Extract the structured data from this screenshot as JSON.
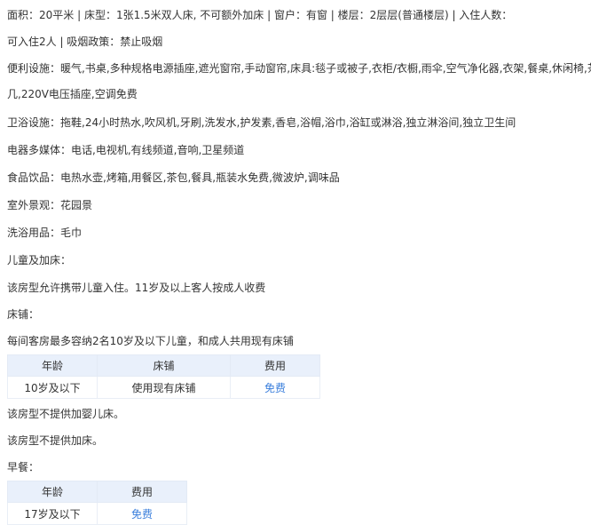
{
  "lines": {
    "area_line": "面积：20平米 | 床型：1张1.5米双人床, 不可额外加床 | 窗户：有窗 | 楼层：2层层(普通楼层) | 入住人数：",
    "occupancy_line": "可入住2人 | 吸烟政策：禁止吸烟",
    "facilities_line1": "便利设施：暖气,书桌,多种规格电源插座,遮光窗帘,手动窗帘,床具:毯子或被子,衣柜/衣橱,雨伞,空气净化器,衣架,餐桌,休闲椅,茶",
    "facilities_line2": "几,220V电压插座,空调免费",
    "bathroom_line": "卫浴设施：拖鞋,24小时热水,吹风机,牙刷,洗发水,护发素,香皂,浴帽,浴巾,浴缸或淋浴,独立淋浴间,独立卫生间",
    "media_line": "电器多媒体：电话,电视机,有线频道,音响,卫星频道",
    "food_line": "食品饮品：电热水壶,烤箱,用餐区,茶包,餐具,瓶装水免费,微波炉,调味品",
    "view_line": "室外景观：花园景",
    "toiletries_line": "洗浴用品：毛巾",
    "children_heading": "儿童及加床：",
    "children_policy": "该房型允许携带儿童入住。11岁及以上客人按成人收费",
    "bedding_heading": "床铺：",
    "bedding_note": "每间客房最多容纳2名10岁及以下儿童，和成人共用现有床铺",
    "crib_note": "该房型不提供加婴儿床。",
    "extra_bed_note": "该房型不提供加床。",
    "breakfast_heading": "早餐："
  },
  "bedding_table": {
    "headers": [
      "年龄",
      "床铺",
      "费用"
    ],
    "row": [
      "10岁及以下",
      "使用现有床铺",
      "免费"
    ]
  },
  "breakfast_table": {
    "headers": [
      "年龄",
      "费用"
    ],
    "row": [
      "17岁及以下",
      "免费"
    ]
  },
  "colors": {
    "table_header_bg": "#e9f0fb",
    "free_link": "#3b7fdc",
    "text": "#333333"
  }
}
